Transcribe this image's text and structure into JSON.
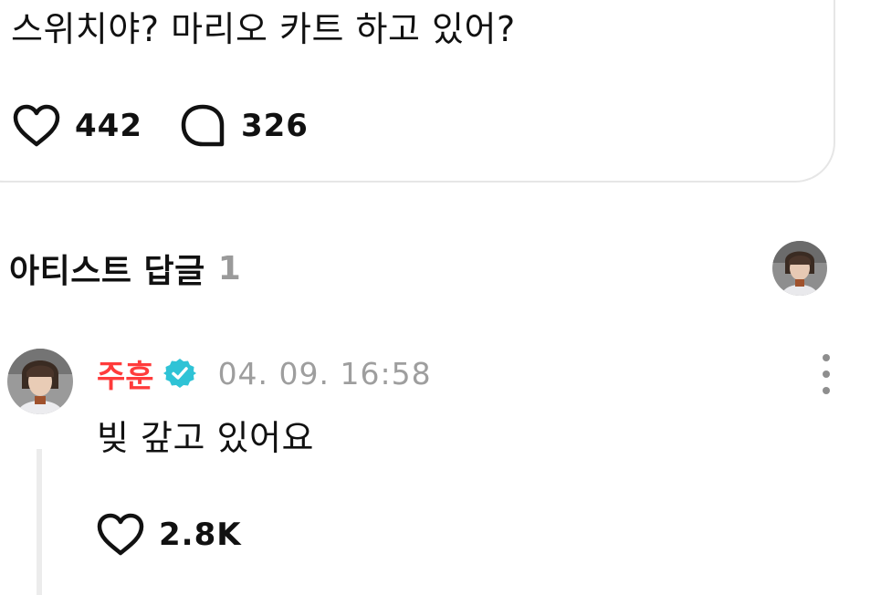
{
  "post": {
    "text": "스위치야? 마리오 카트 하고 있어?",
    "likes": "442",
    "comments": "326"
  },
  "artist_replies": {
    "title": "아티스트 답글",
    "count": "1"
  },
  "comment": {
    "author": "주훈",
    "timestamp": "04. 09. 16:58",
    "body": "빚 갚고 있어요",
    "likes": "2.8K"
  },
  "colors": {
    "author_name": "#ff3b3b",
    "verified_badge": "#2fc3d6",
    "muted_text": "#9e9e9e"
  },
  "icons": {
    "like": "heart-icon",
    "comment": "speech-bubble-icon",
    "verified": "verified-badge-icon",
    "more": "more-vertical-icon"
  }
}
